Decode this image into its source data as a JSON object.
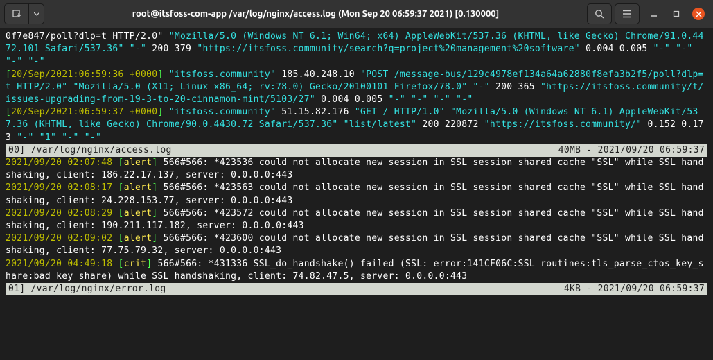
{
  "titlebar": {
    "title": "root@itsfoss-com-app /var/log/nginx/access.log (Mon Sep 20 06:59:37 2021) [0.130000]"
  },
  "access": {
    "l1a": "0f7e847/poll?dlp=t HTTP/2.0\" ",
    "l1b": "\"Mozilla/5.0 (Windows NT 6.1; Win64; x64) AppleWebKit/537.36 (KHTML, like Gecko) Chrome/91.0.4472.101 Safari/537.36\" \"-\"",
    "l1c": " 200 379 ",
    "l1d": "\"https://itsfoss.community/search?q=project%20management%20software\"",
    "l1e": " 0.004 0.005 ",
    "l1f": "\"-\" \"-\" \"-\" \"-\"",
    "l2open": "[",
    "l2ts": "20/Sep/2021:06:59:36 +0000",
    "l2close": "]",
    "l2a": " \"itsfoss.community\"",
    "l2b": " 185.40.248.10 ",
    "l2c": "\"POST /message-bus/129c4978ef134a64a62880f8efa3b2f5/poll?dlp=t HTTP/2.0\" \"Mozilla/5.0 (X11; Linux x86_64; rv:78.0) Gecko/20100101 Firefox/78.0\" \"-\"",
    "l2d": " 200 365 ",
    "l2e": "\"https://itsfoss.community/t/issues-upgrading-from-19-3-to-20-cinnamon-mint/5103/27\"",
    "l2f": " 0.004 0.005 ",
    "l2g": "\"-\" \"-\" \"-\" \"-\"",
    "l3open": "[",
    "l3ts": "20/Sep/2021:06:59:37 +0000",
    "l3close": "]",
    "l3a": " \"itsfoss.community\"",
    "l3b": " 51.15.82.176 ",
    "l3c": "\"GET / HTTP/1.0\" \"Mozilla/5.0 (Windows NT 6.1) AppleWebKit/537.36 (KHTML, like Gecko) Chrome/90.0.4430.72 Safari/537.36\" \"list/latest\"",
    "l3d": " 200 220872 ",
    "l3e": "\"https://itsfoss.community/\"",
    "l3f": " 0.152 0.173 ",
    "l3g": "\"-\" \"1\" \"-\" \"-\""
  },
  "status_access": {
    "left": "00] /var/log/nginx/access.log",
    "right": "40MB - 2021/09/20 06:59:37"
  },
  "error": {
    "e1ts": "2021/09/20 02:07:48",
    "e1br": " [",
    "e1lvl": "alert",
    "e1brc": "] ",
    "e1pid": "566#566: ",
    "e1msg": "*423536 could not allocate new session in SSL session shared cache \"SSL\" while SSL handshaking, client: 186.22.17.137, server: 0.0.0.0:443",
    "e2ts": "2021/09/20 02:08:17",
    "e2pid": "566#566: ",
    "e2msg": "*423563 could not allocate new session in SSL session shared cache \"SSL\" while SSL handshaking, client: 24.228.153.77, server: 0.0.0.0:443",
    "e3ts": "2021/09/20 02:08:29",
    "e3pid": "566#566: ",
    "e3msg": "*423572 could not allocate new session in SSL session shared cache \"SSL\" while SSL handshaking, client: 190.211.117.182, server: 0.0.0.0:443",
    "e4ts": "2021/09/20 02:09:02",
    "e4pid": "566#566: ",
    "e4msg": "*423600 could not allocate new session in SSL session shared cache \"SSL\" while SSL handshaking, client: 77.75.79.32, server: 0.0.0.0:443",
    "e5ts": "2021/09/20 04:49:18",
    "e5br": " [",
    "e5lvl": "crit",
    "e5brc": "] ",
    "e5pid": "566#566: ",
    "e5msg": "*431336 SSL_do_handshake() failed (SSL: error:141CF06C:SSL routines:tls_parse_ctos_key_share:bad key share) while SSL handshaking, client: 74.82.47.5, server: 0.0.0.0:443",
    "alert": "alert"
  },
  "status_error": {
    "left": "01] /var/log/nginx/error.log",
    "right": "4KB - 2021/09/20 06:59:37"
  }
}
